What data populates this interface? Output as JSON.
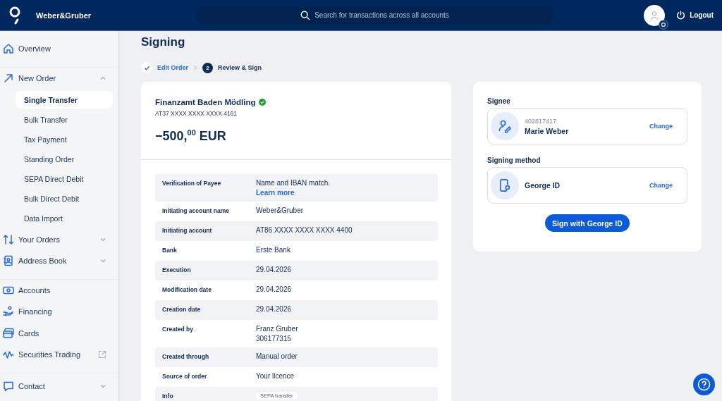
{
  "header": {
    "company": "Weber&Gruber",
    "search": {
      "placeholder": "Search for transactions across all accounts"
    },
    "logout": "Logout"
  },
  "sidebar": {
    "groups": [
      {
        "items": [
          {
            "label": "Overview",
            "kind": "link"
          }
        ]
      },
      {
        "items": [
          {
            "label": "New Order",
            "kind": "expandable",
            "expanded": true,
            "children": [
              {
                "label": "Single Transfer",
                "selected": true
              },
              {
                "label": "Bulk Transfer",
                "selected": false
              },
              {
                "label": "Tax Payment",
                "selected": false
              },
              {
                "label": "Standing Order",
                "selected": false
              },
              {
                "label": "SEPA Direct Debit",
                "selected": false
              },
              {
                "label": "Bulk Direct Debit",
                "selected": false
              },
              {
                "label": "Data Import",
                "selected": false
              }
            ]
          },
          {
            "label": "Your Orders",
            "kind": "expandable",
            "expanded": false
          },
          {
            "label": "Address Book",
            "kind": "expandable",
            "expanded": false
          }
        ]
      },
      {
        "items": [
          {
            "label": "Accounts",
            "kind": "link"
          },
          {
            "label": "Financing",
            "kind": "link"
          },
          {
            "label": "Cards",
            "kind": "link"
          },
          {
            "label": "Securities Trading",
            "kind": "external"
          }
        ]
      },
      {
        "items": [
          {
            "label": "Contact",
            "kind": "expandable",
            "expanded": false
          }
        ]
      }
    ]
  },
  "page": {
    "title": "Signing",
    "steps": [
      {
        "label": "Edit Order",
        "done": true
      },
      {
        "number": "2",
        "label": "Review & Sign",
        "done": false
      }
    ]
  },
  "order": {
    "payee": "Finanzamt Baden Mödling",
    "verified": true,
    "iban": "AT37 XXXX XXXX XXXX 4161",
    "amount": "−500,$^{00}$ EUR",
    "details": [
      {
        "label": "Verification of Payee",
        "values": [
          "Name and IBAN match."
        ],
        "link": "Learn more"
      },
      {
        "label": "Initiating account name",
        "values": [
          "Weber&Gruber"
        ]
      },
      {
        "label": "Initiating account",
        "values": [
          "AT86 XXXX XXXX XXXX 4400"
        ]
      },
      {
        "label": "Bank",
        "values": [
          "Erste Bank"
        ]
      },
      {
        "label": "Execution",
        "values": [
          "29.04.2026"
        ]
      },
      {
        "label": "Modification date",
        "values": [
          "29.04.2026"
        ]
      },
      {
        "label": "Creation date",
        "values": [
          "29.04.2026"
        ]
      },
      {
        "label": "Created by",
        "values": [
          "Franz Gruber",
          "306177315"
        ]
      },
      {
        "label": "Created through",
        "values": [
          "Manual order"
        ]
      },
      {
        "label": "Source of order",
        "values": [
          "Your licence"
        ]
      },
      {
        "label": "Info",
        "badge": "SEPA transfer"
      }
    ]
  },
  "signing": {
    "signee_label": "Signee",
    "signee": {
      "id": "402817417",
      "name": "Marie Weber",
      "action": "Change"
    },
    "method_label": "Signing method",
    "method": {
      "name": "George ID",
      "action": "Change"
    },
    "sign_button": "Sign with George ID"
  }
}
